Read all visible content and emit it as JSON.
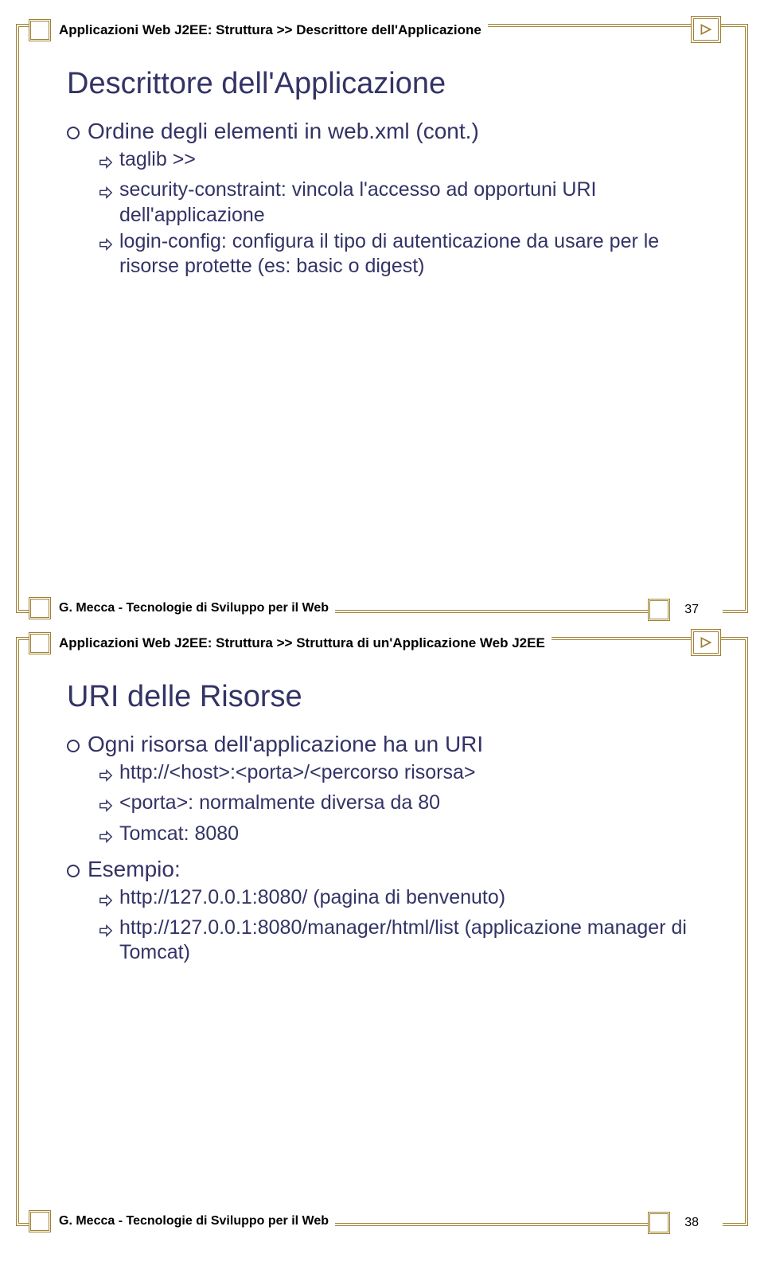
{
  "slide1": {
    "breadcrumb": "Applicazioni Web J2EE: Struttura >> Descrittore dell'Applicazione",
    "title": "Descrittore dell'Applicazione",
    "bullet1": "Ordine degli elementi in web.xml (cont.)",
    "sub1": "taglib >>",
    "sub2": "security-constraint: vincola l'accesso ad opportuni URI dell'applicazione",
    "sub3": "login-config: configura il tipo di autenticazione da usare per le risorse protette (es: basic o digest)",
    "footer": "G. Mecca - Tecnologie di Sviluppo per il Web",
    "page": "37"
  },
  "slide2": {
    "breadcrumb": "Applicazioni Web J2EE: Struttura >> Struttura di un'Applicazione Web J2EE",
    "title": "URI delle Risorse",
    "bullet1": "Ogni risorsa dell'applicazione ha un URI",
    "sub1a": "http://<host>:<porta>/<percorso risorsa>",
    "sub1b": "<porta>: normalmente diversa da 80",
    "sub1c": "Tomcat: 8080",
    "bullet2": "Esempio:",
    "sub2a": "http://127.0.0.1:8080/   (pagina di benvenuto)",
    "sub2b": "http://127.0.0.1:8080/manager/html/list (applicazione manager di Tomcat)",
    "footer": "G. Mecca - Tecnologie di Sviluppo per il Web",
    "page": "38"
  }
}
